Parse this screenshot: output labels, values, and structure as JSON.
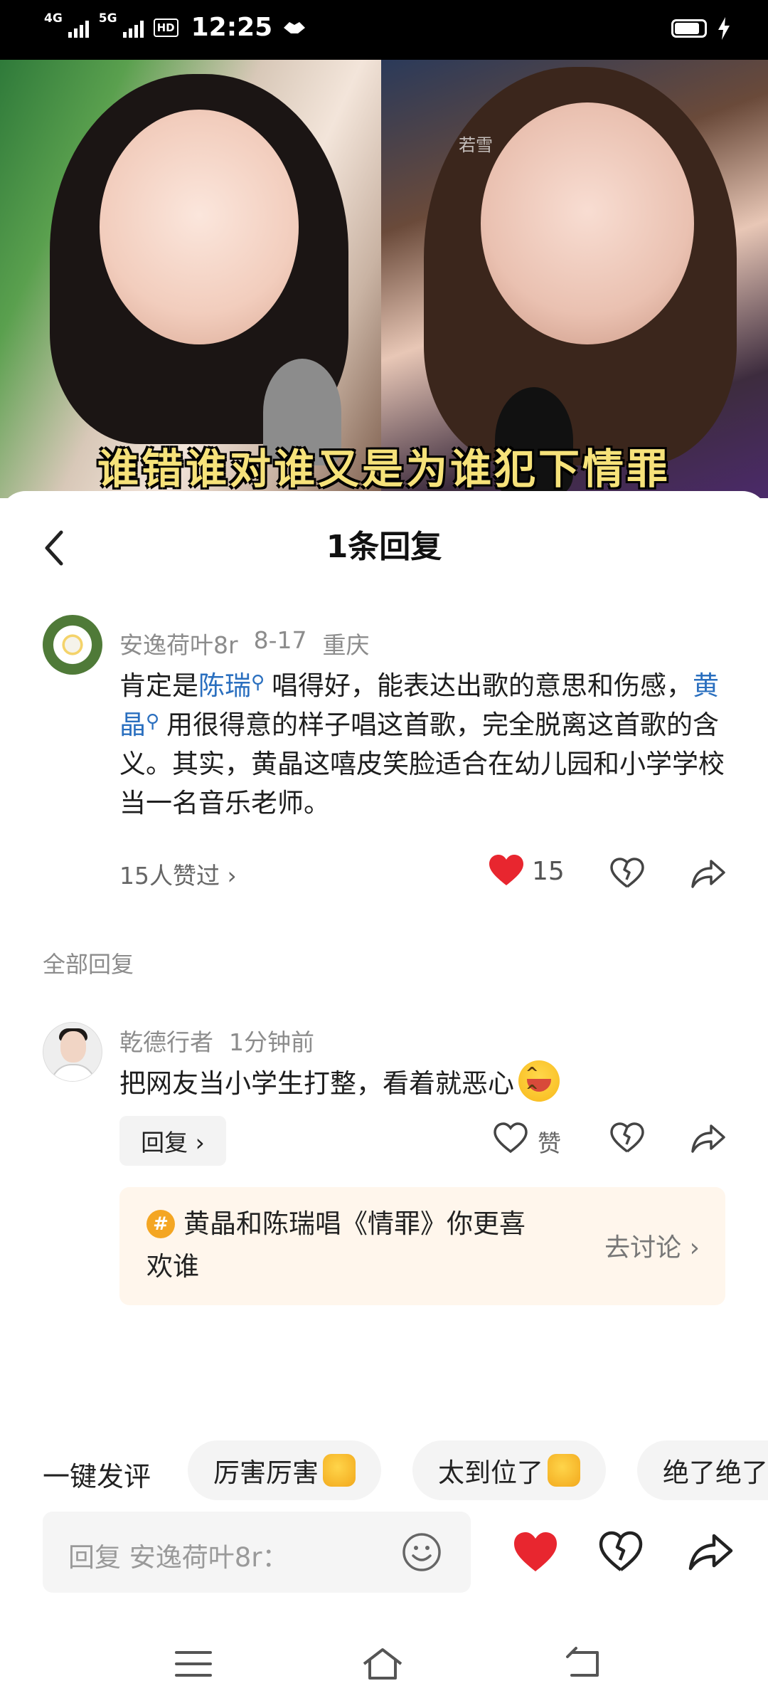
{
  "status_bar": {
    "network_1": "4G",
    "network_2": "5G",
    "hd_label": "HD",
    "time": "12:25"
  },
  "video": {
    "subtitle": "谁错谁对谁又是为谁犯下情罪",
    "watermark": "若雪"
  },
  "sheet": {
    "title": "1条回复"
  },
  "main_comment": {
    "author": "安逸荷叶8r",
    "date": "8-17",
    "location": "重庆",
    "text_parts": {
      "p1": "肯定是",
      "link1": "陈瑞",
      "p2": "唱得好，能表达出歌的意思和伤感，",
      "link2": "黄晶",
      "p3": "用很得意的样子唱这首歌，完全脱离这首歌的含义。其实，黄晶这嘻皮笑脸适合在幼儿园和小学学校当一名音乐老师。"
    },
    "likers_text": "15人赞过 ›",
    "like_count": "15"
  },
  "section_label": "全部回复",
  "reply": {
    "author": "乾德行者",
    "time": "1分钟前",
    "text": "把网友当小学生打整，看着就恶心",
    "reply_button": "回复 ›",
    "like_label": "赞"
  },
  "topic": {
    "hash": "#",
    "text": "黄晶和陈瑞唱《情罪》你更喜欢谁",
    "action": "去讨论 ›"
  },
  "quick_comment": {
    "label": "一键发评",
    "chips": [
      "厉害厉害",
      "太到位了",
      "绝了绝了"
    ]
  },
  "input": {
    "placeholder": "回复 安逸荷叶8r："
  },
  "colors": {
    "link": "#2a6fbf",
    "like_red": "#e8262f",
    "topic_bg": "#fff6ec"
  }
}
